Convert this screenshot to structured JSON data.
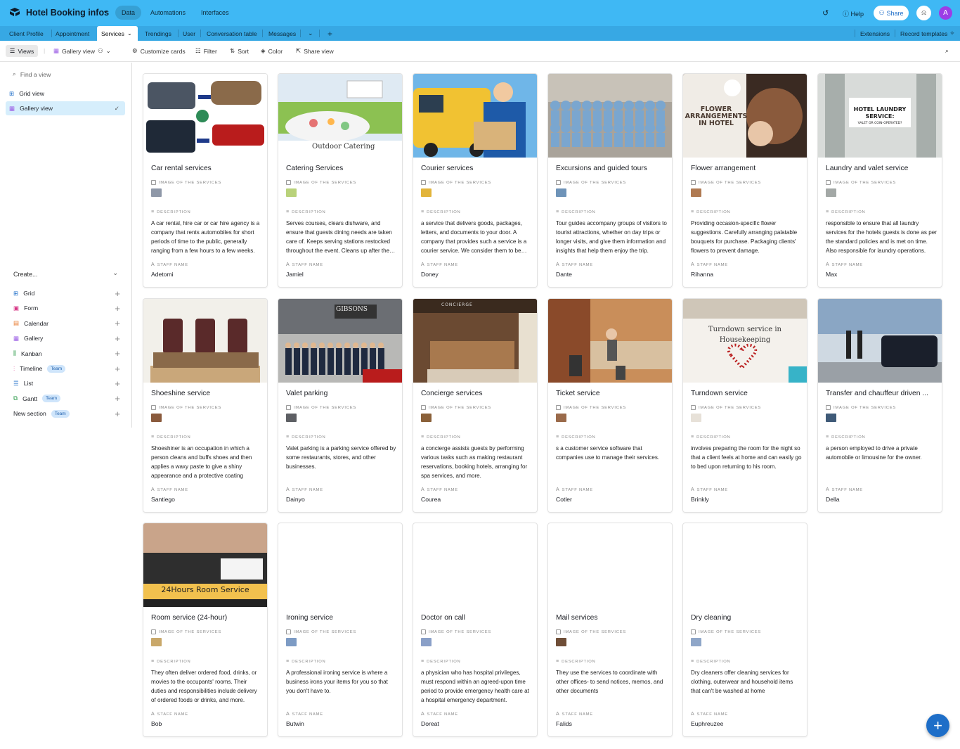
{
  "header": {
    "base_title": "Hotel Booking infos",
    "nav": [
      "Data",
      "Automations",
      "Interfaces"
    ],
    "help": "Help",
    "share": "Share",
    "avatar_letter": "A"
  },
  "tabs": [
    "Client Profile",
    "Appointment",
    "Services",
    "Trendings",
    "User",
    "Conversation table",
    "Messages"
  ],
  "tabbar_right": {
    "extensions": "Extensions",
    "record_templates": "Record templates"
  },
  "toolbar": {
    "views": "Views",
    "gallery_view": "Gallery view",
    "customize_cards": "Customize cards",
    "filter": "Filter",
    "sort": "Sort",
    "color": "Color",
    "share_view": "Share view"
  },
  "sidebar": {
    "search_placeholder": "Find a view",
    "views": [
      "Grid view",
      "Gallery view"
    ],
    "create_label": "Create...",
    "create_items": [
      {
        "label": "Grid",
        "team": ""
      },
      {
        "label": "Form",
        "team": ""
      },
      {
        "label": "Calendar",
        "team": ""
      },
      {
        "label": "Gallery",
        "team": ""
      },
      {
        "label": "Kanban",
        "team": ""
      },
      {
        "label": "Timeline",
        "team": "Team"
      },
      {
        "label": "List",
        "team": ""
      },
      {
        "label": "Gantt",
        "team": "Team"
      },
      {
        "label": "New section",
        "team": "Team"
      }
    ]
  },
  "field_labels": {
    "image": "IMAGE OF THE SERVICES",
    "description": "DESCRIPTION",
    "staff": "STAFF NAME"
  },
  "image_captions": {
    "outdoor_catering": "Outdoor Catering",
    "flower": "FLOWER ARRANGEMENTS IN HOTEL",
    "laundry": "HOTEL LAUNDRY SERVICE:",
    "laundry_sub": "VALET OR COIN-OPERATED?",
    "concierge": "CONCIERGE",
    "turndown": "Turndown service in Housekeeping",
    "room_service": "24Hours Room Service",
    "gibsons": "GIBSONS"
  },
  "cards": [
    {
      "title": "Car rental services",
      "description": "A car rental, hire car or car hire agency is a company that rents automobiles for short periods of time to the public, generally ranging from a few hours to a few weeks.",
      "staff": "Adetomi",
      "color": "#8f98a8"
    },
    {
      "title": "Catering Services",
      "description": "Serves courses, clears dishware, and ensure that guests dining needs are taken care of. Keeps serving stations restocked throughout the event. Cleans up after the event.",
      "staff": "Jamiel",
      "color": "#b9d27a"
    },
    {
      "title": "Courier services",
      "description": " a service that delivers goods, packages, letters, and documents to your door. A company that provides such a service is a courier service. We consider them to be reliable.",
      "staff": "Doney",
      "color": "#e2b43a"
    },
    {
      "title": "Excursions and guided tours",
      "description": "Tour guides accompany groups of visitors to tourist attractions, whether on day trips or longer visits, and give them information and insights that help them enjoy the trip.",
      "staff": "Dante",
      "color": "#6e93b8"
    },
    {
      "title": "Flower arrangement",
      "description": "Providing occasion-specific flower suggestions. Carefully arranging palatable bouquets for purchase. Packaging clients' flowers to prevent damage.",
      "staff": "Rihanna",
      "color": "#b07a52"
    },
    {
      "title": "Laundry and valet service",
      "description": " responsible to ensure that all laundry services for the hotels guests is done as per the standard policies and is met on time. Also responsible for laundry operations.",
      "staff": "Max",
      "color": "#a3a8a6"
    },
    {
      "title": "Shoeshine service",
      "description": "Shoeshiner  is an occupation in which a person cleans and buffs shoes and then applies a waxy paste to give a shiny appearance and a protective coating",
      "staff": "Santiego",
      "color": "#8a5a3c"
    },
    {
      "title": "Valet parking",
      "description": "Valet parking is a parking service offered by some restaurants, stores, and other businesses.",
      "staff": "Dainyo",
      "color": "#5d5f64"
    },
    {
      "title": "Concierge services",
      "description": "a concierge assists guests by performing various tasks such as making restaurant reservations, booking hotels, arranging for spa services, and more.",
      "staff": "Courea",
      "color": "#8a6039"
    },
    {
      "title": "Ticket service",
      "description": "s a customer service software that companies use to manage their services.",
      "staff": "Cotler",
      "color": "#9a6a4a"
    },
    {
      "title": "Turndown service",
      "description": " involves preparing the room for the night so that a client feels at home and can easily go to bed upon returning to his room.",
      "staff": "Brinkly",
      "color": "#e7e1d8"
    },
    {
      "title": "Transfer and chauffeur driven ...",
      "description": "a person employed to drive a private automobile or limousine for the owner.",
      "staff": "Della",
      "color": "#3f5a78"
    },
    {
      "title": "Room service (24-hour)",
      "description": "They often deliver ordered food, drinks, or movies to the occupants' rooms. Their duties and responsibilities include delivery of ordered foods or drinks, and more.",
      "staff": "Bob",
      "color": "#c9a86a"
    },
    {
      "title": "Ironing service",
      "description": "A professional ironing service is where a business irons your items for you so that you don't have to.",
      "staff": "Butwin",
      "color": "#7d9bc4"
    },
    {
      "title": "Doctor on call",
      "description": "a physician who has hospital privileges, must respond within an agreed-upon time period to provide emergency health care at a hospital emergency department.",
      "staff": "Doreat",
      "color": "#8aa0c8"
    },
    {
      "title": "Mail services",
      "description": "They use the services to coordinate with other offices- to send notices, memos, and other documents",
      "staff": "Falids",
      "color": "#6f4e37"
    },
    {
      "title": "Dry cleaning",
      "description": "Dry cleaners offer cleaning services for clothing, outerwear and household items that can't be washed at home",
      "staff": "Euphreuzee",
      "color": "#8fa6c8"
    }
  ]
}
